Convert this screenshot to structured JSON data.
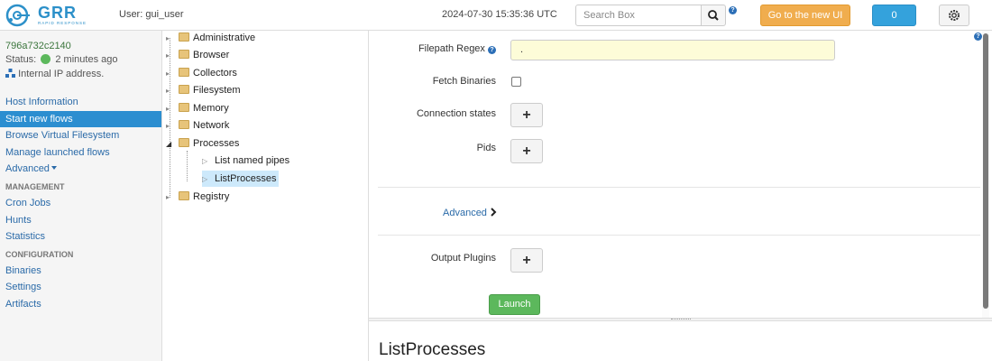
{
  "header": {
    "logo_text": "GRR",
    "logo_sub": "RAPID RESPONSE",
    "user_label": "User: gui_user",
    "clock": "2024-07-30 15:35:36 UTC",
    "search_placeholder": "Search Box",
    "new_ui_label": "Go to the new UI",
    "notification_count": "0"
  },
  "client": {
    "id": "796a732c2140",
    "status_label": "Status:",
    "status_value": "2 minutes ago",
    "ip_text": "Internal IP address."
  },
  "nav": {
    "host_information": "Host Information",
    "start_new_flows": "Start new flows",
    "browse_vfs": "Browse Virtual Filesystem",
    "manage_flows": "Manage launched flows",
    "advanced": "Advanced",
    "management_heading": "MANAGEMENT",
    "cron_jobs": "Cron Jobs",
    "hunts": "Hunts",
    "statistics": "Statistics",
    "configuration_heading": "CONFIGURATION",
    "binaries": "Binaries",
    "settings": "Settings",
    "artifacts": "Artifacts"
  },
  "tree": {
    "items": [
      {
        "label": "Administrative"
      },
      {
        "label": "Browser"
      },
      {
        "label": "Collectors"
      },
      {
        "label": "Filesystem"
      },
      {
        "label": "Memory"
      },
      {
        "label": "Network"
      },
      {
        "label": "Processes"
      },
      {
        "label": "List named pipes"
      },
      {
        "label": "ListProcesses"
      },
      {
        "label": "Registry"
      }
    ]
  },
  "form": {
    "filepath_regex_label": "Filepath Regex",
    "filepath_regex_value": ".",
    "fetch_binaries_label": "Fetch Binaries",
    "connection_states_label": "Connection states",
    "pids_label": "Pids",
    "advanced_label": "Advanced",
    "output_plugins_label": "Output Plugins",
    "launch_label": "Launch",
    "plus_symbol": "+",
    "help_symbol": "?"
  },
  "bottom": {
    "title": "ListProcesses"
  },
  "colors": {
    "accent": "#2c8ed0",
    "brand": "#2c90c9",
    "launch_green": "#5cb85c",
    "new_ui_orange": "#f0ad4e",
    "input_yellow": "#fdfcd8"
  }
}
